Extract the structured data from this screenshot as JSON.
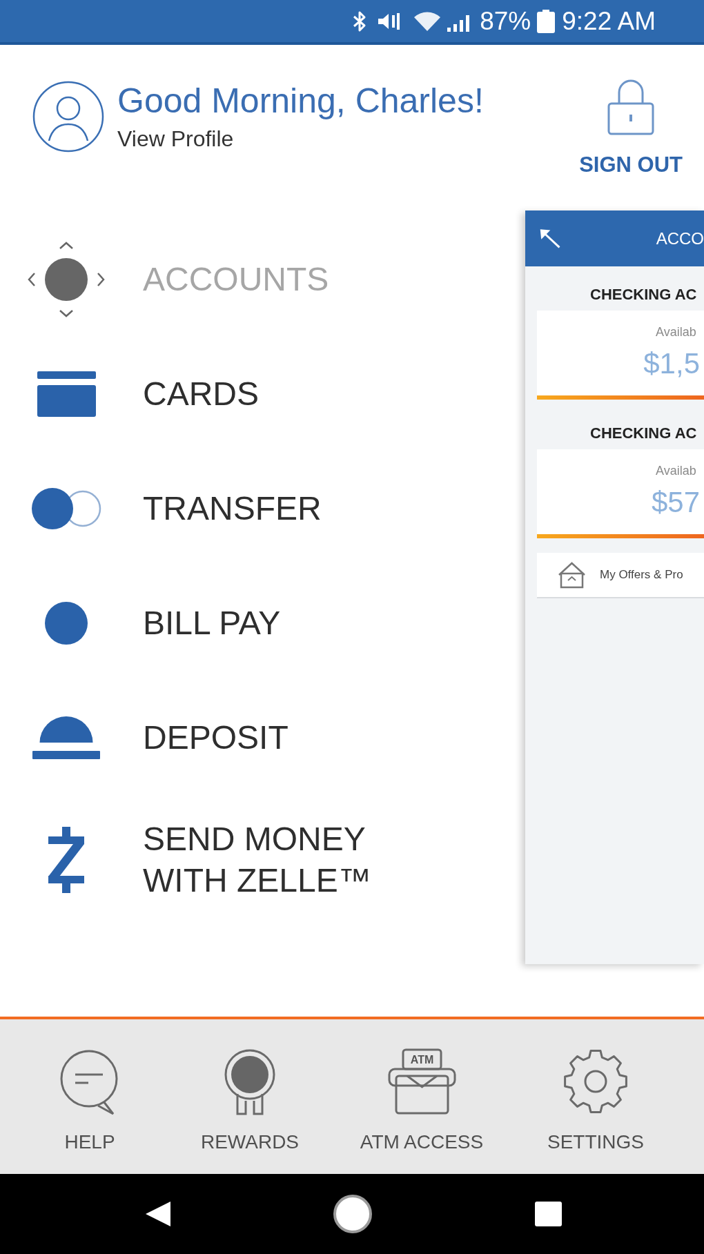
{
  "status_bar": {
    "battery_percent": "87%",
    "time": "9:22 AM"
  },
  "header": {
    "greeting": "Good Morning, Charles!",
    "profile_link": "View Profile",
    "sign_out": "SIGN OUT"
  },
  "menu": [
    {
      "kind": "accounts",
      "label": "ACCOUNTS",
      "selected": true
    },
    {
      "kind": "cards",
      "label": "CARDS",
      "selected": false
    },
    {
      "kind": "transfer",
      "label": "TRANSFER",
      "selected": false
    },
    {
      "kind": "billpay",
      "label": "BILL PAY",
      "selected": false
    },
    {
      "kind": "deposit",
      "label": "DEPOSIT",
      "selected": false
    },
    {
      "kind": "zelle",
      "label": "SEND MONEY WITH ZELLE™",
      "selected": false
    }
  ],
  "accounts_panel": {
    "title": "ACCO",
    "accounts": [
      {
        "heading": "CHECKING AC",
        "balance_label": "Availab",
        "balance": "$1,5"
      },
      {
        "heading": "CHECKING AC",
        "balance_label": "Availab",
        "balance": "$57"
      }
    ],
    "offers": "My Offers & Pro"
  },
  "bottom_nav": [
    {
      "kind": "help",
      "label": "HELP"
    },
    {
      "kind": "rewards",
      "label": "REWARDS"
    },
    {
      "kind": "atm",
      "label": "ATM ACCESS",
      "icon_text": "ATM"
    },
    {
      "kind": "settings",
      "label": "SETTINGS"
    }
  ]
}
